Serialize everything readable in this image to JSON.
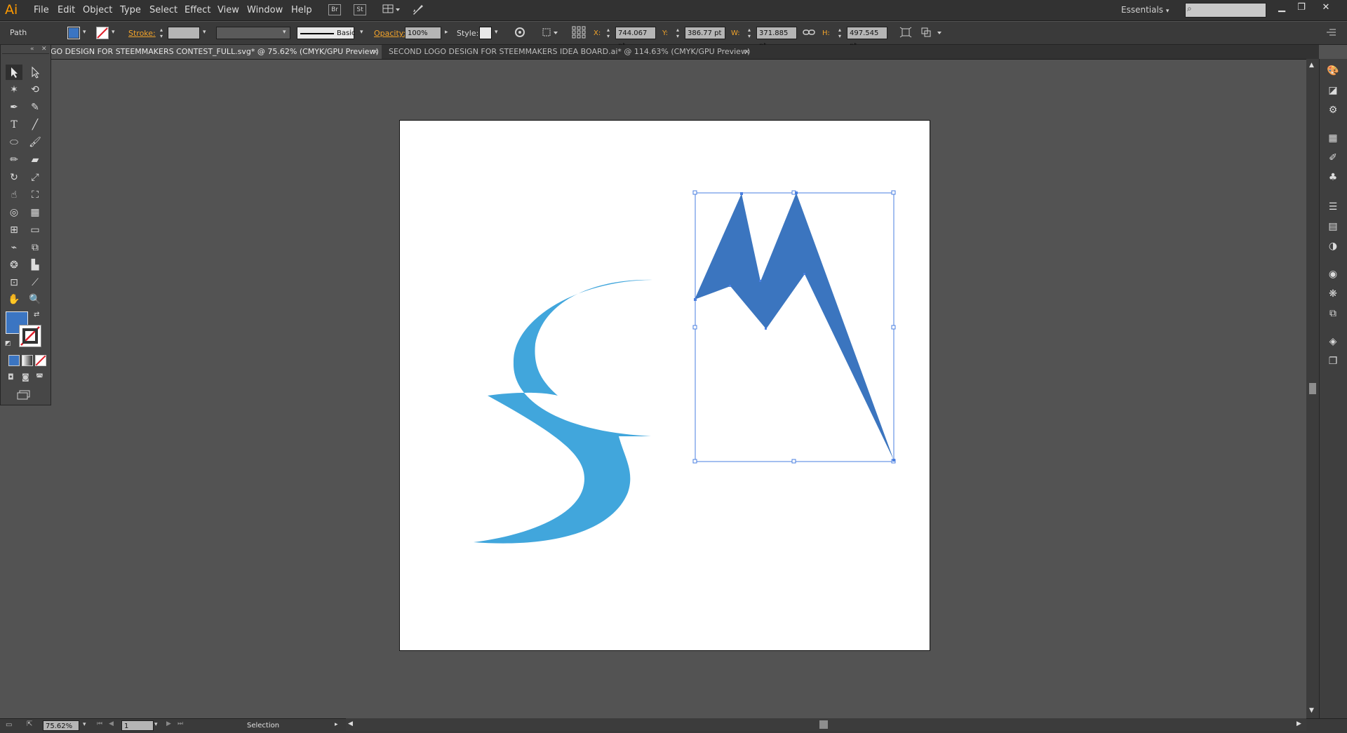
{
  "app": {
    "logo": "Ai",
    "accent": "#ff9a00"
  },
  "menu": [
    "File",
    "Edit",
    "Object",
    "Type",
    "Select",
    "Effect",
    "View",
    "Window",
    "Help"
  ],
  "menu_buttons": {
    "bridge": "Br",
    "stock": "St"
  },
  "workspace": {
    "label": "Essentials"
  },
  "control": {
    "object_type": "Path",
    "fill_color": "#3b75c2",
    "stroke_label": "Stroke:",
    "brush_label": "Basic",
    "opacity_label": "Opacity:",
    "opacity_value": "100%",
    "style_label": "Style:",
    "x_label": "X:",
    "x_value": "744.067 pt",
    "y_label": "Y:",
    "y_value": "386.77 pt",
    "w_label": "W:",
    "w_value": "371.885 pt",
    "h_label": "H:",
    "h_value": "497.545 pt"
  },
  "tabs": [
    {
      "label": "GO DESIGN FOR STEEMMAKERS CONTEST_FULL.svg* @ 75.62% (CMYK/GPU Preview)",
      "active": true
    },
    {
      "label": "SECOND LOGO DESIGN FOR STEEMMAKERS IDEA BOARD.ai* @ 114.63% (CMYK/GPU Preview)",
      "active": false
    }
  ],
  "artwork": {
    "s_color": "#41a6dc",
    "m_color": "#3b75bf",
    "selection_color": "#4a7fe0"
  },
  "tools_panel": {
    "fill_color": "#3b75c2",
    "icons": [
      "selection-tool",
      "direct-selection-tool",
      "magic-wand-tool",
      "lasso-tool",
      "pen-tool",
      "curvature-tool",
      "type-tool",
      "line-tool",
      "ellipse-tool",
      "paintbrush-tool",
      "pencil-tool",
      "eraser-tool",
      "rotate-tool",
      "scale-tool",
      "warp-tool",
      "free-transform-tool",
      "shape-builder-tool",
      "perspective-grid-tool",
      "mesh-tool",
      "gradient-tool",
      "eyedropper-tool",
      "blend-tool",
      "symbol-sprayer-tool",
      "column-graph-tool",
      "artboard-tool",
      "slice-tool",
      "hand-tool",
      "zoom-tool"
    ]
  },
  "status": {
    "zoom": "75.62%",
    "artboard_number": "1",
    "tool_name": "Selection"
  }
}
